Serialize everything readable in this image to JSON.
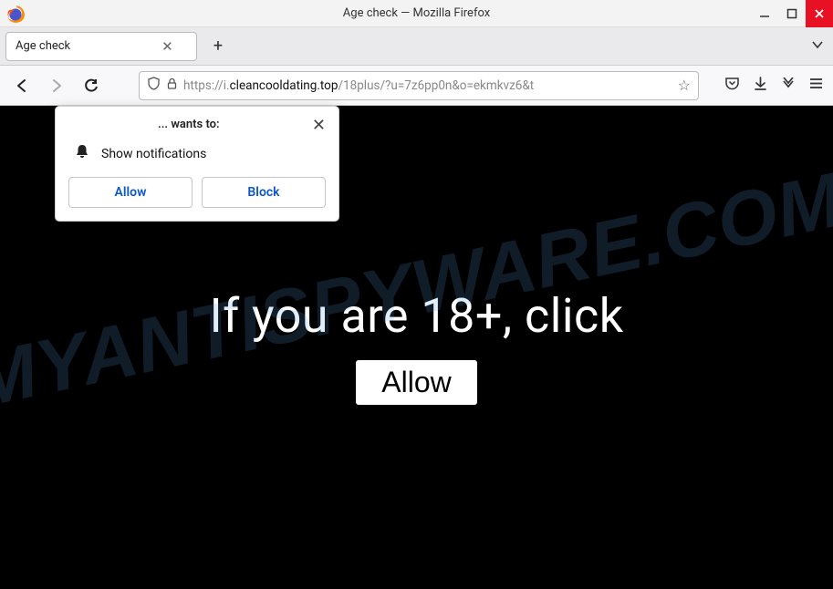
{
  "titlebar": {
    "title": "Age check — Mozilla Firefox"
  },
  "tabs": {
    "active_label": "Age check"
  },
  "url": {
    "scheme": "https://",
    "sub": "i.",
    "domain": "cleancooldating.top",
    "path": "/18plus/?u=7z6pp0n&o=ekmkvz6&t"
  },
  "notification": {
    "wants_label": "... wants to:",
    "permission": "Show notifications",
    "allow_label": "Allow",
    "block_label": "Block"
  },
  "page": {
    "headline": "If you are 18+, click",
    "button": "Allow"
  },
  "watermark": "MYANTISPYWARE.COM"
}
